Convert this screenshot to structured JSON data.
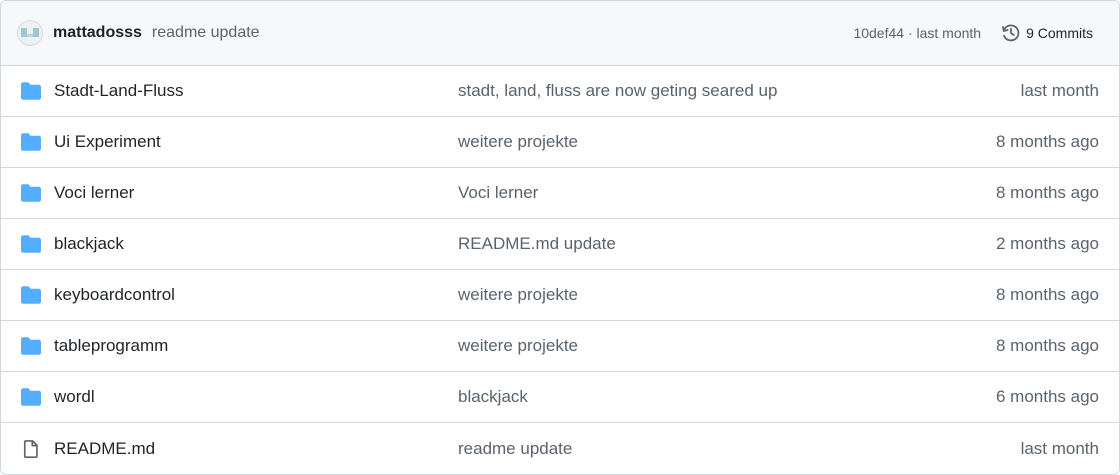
{
  "header": {
    "avatar_icon": "identicon-avatar",
    "author": "mattadosss",
    "commit_message": "readme update",
    "sha_and_time": "10def44 · last month",
    "history_icon": "history-icon",
    "commits_label": "9 Commits"
  },
  "colors": {
    "folder": "#54aeff",
    "file_icon": "#59636e",
    "muted_text": "#59636e",
    "header_bg": "#f6f8fa",
    "border": "#d0d7de"
  },
  "files": [
    {
      "type": "folder",
      "icon": "folder-icon",
      "name": "Stadt-Land-Fluss",
      "message": "stadt, land, fluss are now geting seared up",
      "date": "last month"
    },
    {
      "type": "folder",
      "icon": "folder-icon",
      "name": "Ui Experiment",
      "message": "weitere projekte",
      "date": "8 months ago"
    },
    {
      "type": "folder",
      "icon": "folder-icon",
      "name": "Voci lerner",
      "message": "Voci lerner",
      "date": "8 months ago"
    },
    {
      "type": "folder",
      "icon": "folder-icon",
      "name": "blackjack",
      "message": "README.md update",
      "date": "2 months ago"
    },
    {
      "type": "folder",
      "icon": "folder-icon",
      "name": "keyboardcontrol",
      "message": "weitere projekte",
      "date": "8 months ago"
    },
    {
      "type": "folder",
      "icon": "folder-icon",
      "name": "tableprogramm",
      "message": "weitere projekte",
      "date": "8 months ago"
    },
    {
      "type": "folder",
      "icon": "folder-icon",
      "name": "wordl",
      "message": "blackjack",
      "date": "6 months ago"
    },
    {
      "type": "file",
      "icon": "file-icon",
      "name": "README.md",
      "message": "readme update",
      "date": "last month"
    }
  ]
}
